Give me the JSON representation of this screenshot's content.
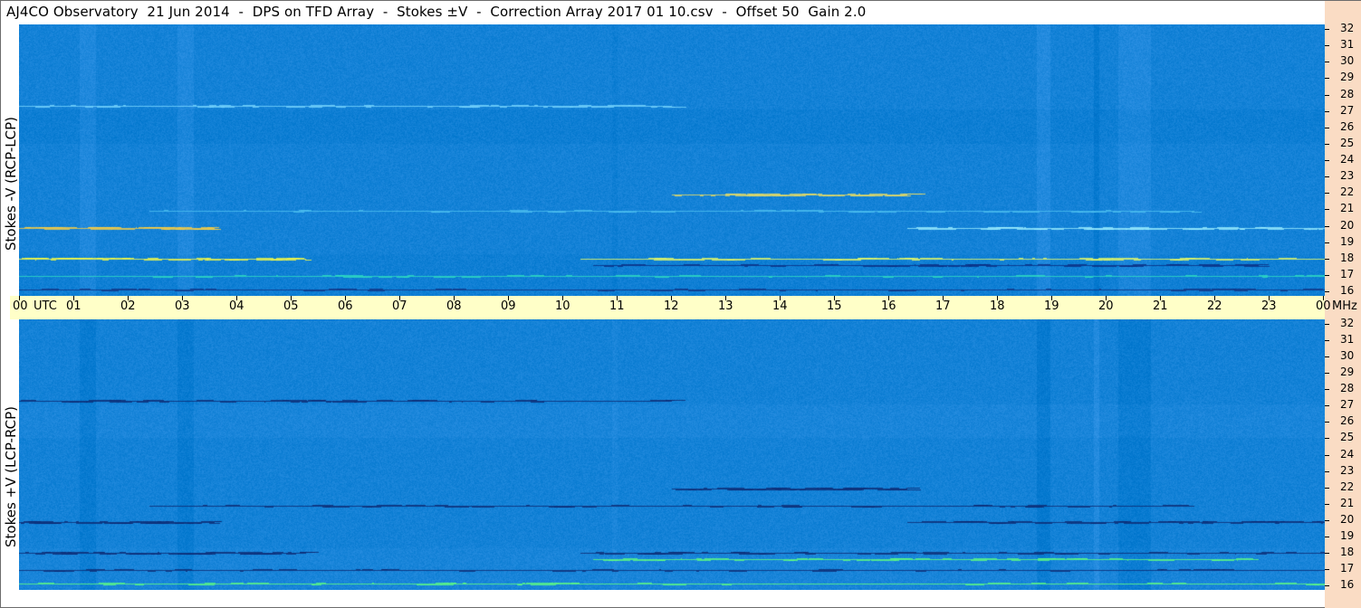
{
  "title": "AJ4CO Observatory  21 Jun 2014  -  DPS on TFD Array  -  Stokes ±V  -  Correction Array 2017 01 10.csv  -  Offset 50  Gain 2.0",
  "colors": {
    "background_field": "#1f67e6",
    "time_band": "#ffffc8",
    "freq_strip": "#fadcc4"
  },
  "chart_data": [
    {
      "type": "heatmap",
      "ylabel": "Stokes -V  (RCP-LCP)",
      "y_unit": "MHz",
      "ylim": [
        16,
        32
      ],
      "y_ticks": [
        "32",
        "31",
        "30",
        "29",
        "28",
        "27",
        "26",
        "25",
        "24",
        "23",
        "22",
        "21",
        "20",
        "19",
        "18",
        "17",
        "16"
      ],
      "x_ticks": [
        "00",
        "01",
        "02",
        "03",
        "04",
        "05",
        "06",
        "07",
        "08",
        "09",
        "10",
        "11",
        "12",
        "13",
        "14",
        "15",
        "16",
        "17",
        "18",
        "19",
        "20",
        "21",
        "22",
        "23",
        "00"
      ],
      "x_unit": "UTC"
    },
    {
      "type": "heatmap",
      "ylabel": "Stokes +V  (LCP-RCP)",
      "y_unit": "MHz",
      "ylim": [
        16,
        32
      ],
      "y_ticks": [
        "32",
        "31",
        "30",
        "29",
        "28",
        "27",
        "26",
        "25",
        "24",
        "23",
        "22",
        "21",
        "20",
        "19",
        "18",
        "17",
        "16"
      ],
      "x_ticks": [
        "00",
        "01",
        "02",
        "03",
        "04",
        "05",
        "06",
        "07",
        "08",
        "09",
        "10",
        "11",
        "12",
        "13",
        "14",
        "15",
        "16",
        "17",
        "18",
        "19",
        "20",
        "21",
        "22",
        "23",
        "00"
      ],
      "x_unit": "UTC"
    }
  ],
  "time_axis": {
    "utc_label": "UTC",
    "mhz_label": "MHz"
  }
}
